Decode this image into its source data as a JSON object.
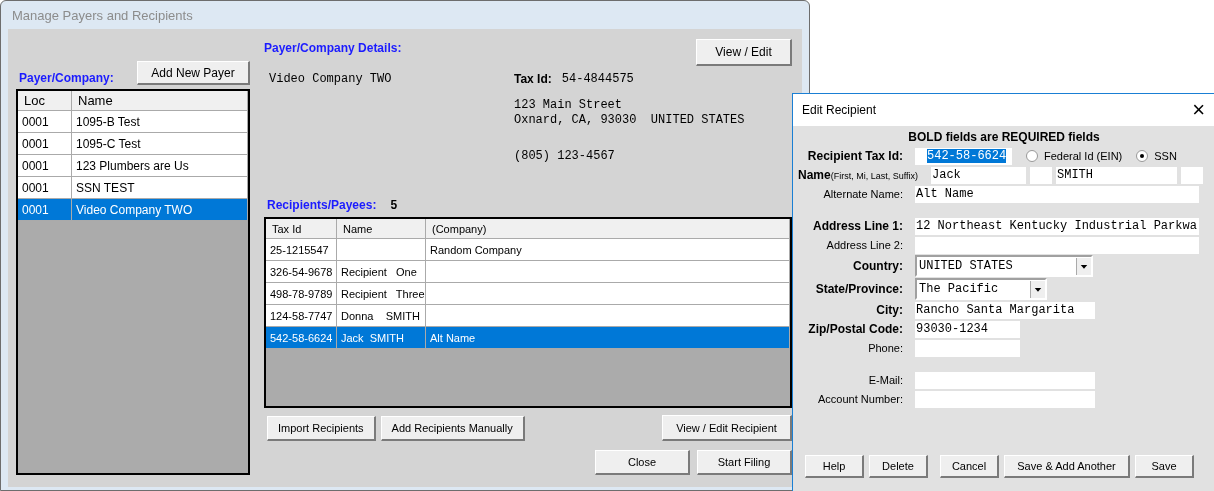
{
  "window": {
    "title": "Manage Payers and Recipients"
  },
  "payers": {
    "heading": "Payer/Company:",
    "add_button": "Add New Payer",
    "columns": [
      "Loc",
      "Name"
    ],
    "rows": [
      {
        "loc": "0001",
        "name": "1095-B Test",
        "selected": false
      },
      {
        "loc": "0001",
        "name": "1095-C Test",
        "selected": false
      },
      {
        "loc": "0001",
        "name": "123 Plumbers are Us",
        "selected": false
      },
      {
        "loc": "0001",
        "name": "SSN TEST",
        "selected": false
      },
      {
        "loc": "0001",
        "name": "Video Company TWO",
        "selected": true
      }
    ]
  },
  "details": {
    "heading": "Payer/Company Details:",
    "view_edit_button": "View / Edit",
    "company_name": "Video Company TWO",
    "tax_id_label": "Tax Id:",
    "tax_id": "54-4844575",
    "address_lines": [
      "123 Main Street",
      "Oxnard, CA, 93030  UNITED STATES"
    ],
    "phone": "(805) 123-4567"
  },
  "recipients": {
    "heading": "Recipients/Payees:",
    "count": "5",
    "columns": [
      "Tax Id",
      "Name",
      "(Company)"
    ],
    "rows": [
      {
        "tax_id": "25-1215547",
        "name": "",
        "company": "Random Company",
        "selected": false
      },
      {
        "tax_id": "326-54-9678",
        "name": "Recipient   One",
        "company": "",
        "selected": false
      },
      {
        "tax_id": "498-78-9789",
        "name": "Recipient   Three",
        "company": "",
        "selected": false
      },
      {
        "tax_id": "124-58-7747",
        "name": "Donna    SMITH",
        "company": "",
        "selected": false
      },
      {
        "tax_id": "542-58-6624",
        "name": "Jack  SMITH",
        "company": "Alt Name",
        "selected": true
      }
    ],
    "buttons": [
      "Import Recipients",
      "Add Recipients Manually"
    ],
    "view_edit_button": "View / Edit Recipient"
  },
  "footer_buttons": [
    "Close",
    "Start Filing"
  ],
  "dialog": {
    "title": "Edit Recipient",
    "close": "×",
    "notice": "BOLD fields are REQUIRED fields",
    "field_groups": [
      [
        {
          "kind": "taxid",
          "label": "Recipient Tax Id:",
          "required": true,
          "value": "542-58-6624",
          "highlighted": true,
          "options": [
            {
              "label": "Federal Id (EIN)",
              "selected": false
            },
            {
              "label": "SSN",
              "selected": true
            }
          ]
        },
        {
          "kind": "name",
          "label": "Name",
          "hint": "(First, Mi, Last, Suffix)",
          "required": true,
          "first": "Jack",
          "last": "SMITH"
        },
        {
          "kind": "long_text",
          "label": "Alternate Name:",
          "required": false,
          "value": "Alt Name"
        }
      ],
      [
        {
          "kind": "long_text",
          "label": "Address Line 1:",
          "required": true,
          "value": "12 Northeast Kentucky Industrial Parkwa"
        },
        {
          "kind": "long_text",
          "label": "Address Line 2:",
          "required": false
        },
        {
          "kind": "wide_select",
          "label": "Country:",
          "required": true,
          "value": "UNITED STATES"
        },
        {
          "kind": "select",
          "label": "State/Province:",
          "required": true,
          "value": "The Pacific"
        },
        {
          "kind": "text",
          "label": "City:",
          "required": true,
          "value": "Rancho Santa Margarita"
        },
        {
          "kind": "short_text",
          "label": "Zip/Postal Code:",
          "required": true,
          "value": "93030-1234"
        },
        {
          "kind": "short_text",
          "label": "Phone:",
          "required": false
        }
      ],
      [
        {
          "kind": "text",
          "label": "E-Mail:",
          "required": false
        },
        {
          "kind": "text",
          "label": "Account Number:",
          "required": false
        }
      ]
    ],
    "buttons": [
      "Help",
      "Delete",
      "Cancel",
      "Save & Add Another",
      "Save"
    ]
  }
}
